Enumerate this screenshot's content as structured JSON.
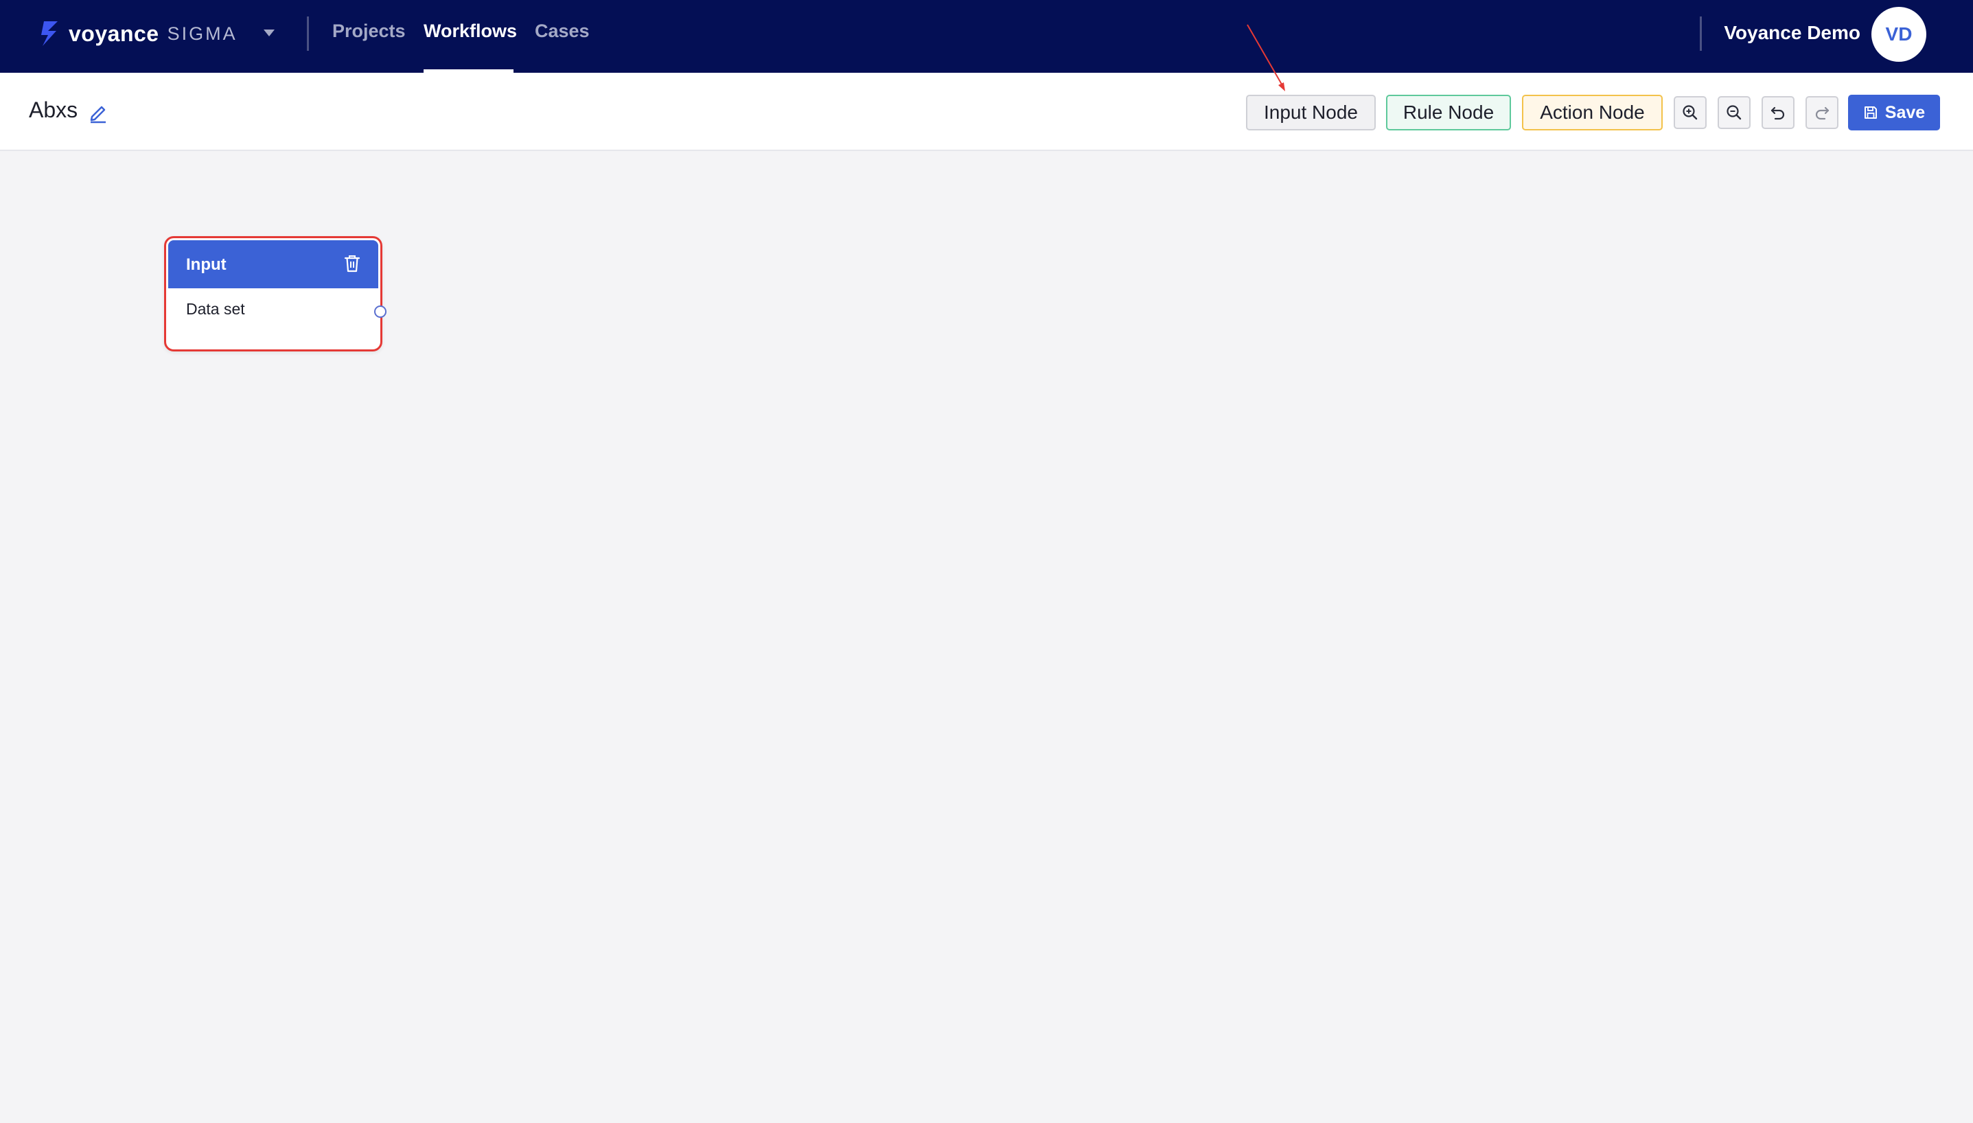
{
  "header": {
    "brand": "voyance",
    "product": "SIGMA",
    "nav": [
      {
        "label": "Projects",
        "active": false
      },
      {
        "label": "Workflows",
        "active": true
      },
      {
        "label": "Cases",
        "active": false
      }
    ],
    "user_name": "Voyance Demo",
    "avatar_initials": "VD"
  },
  "toolbar": {
    "workflow_name": "Abxs",
    "input_node_label": "Input Node",
    "rule_node_label": "Rule Node",
    "action_node_label": "Action Node",
    "save_label": "Save",
    "icons": [
      "zoom-in-icon",
      "zoom-out-icon",
      "undo-icon",
      "redo-icon",
      "save-icon"
    ]
  },
  "canvas": {
    "nodes": [
      {
        "type": "Input",
        "title": "Input",
        "field": "Data set",
        "selected": true
      }
    ]
  },
  "colors": {
    "navbar": "#040f55",
    "accent": "#3b62d6",
    "rule_border": "#5ec99b",
    "action_border": "#f3c24b",
    "selection": "#e53935"
  }
}
